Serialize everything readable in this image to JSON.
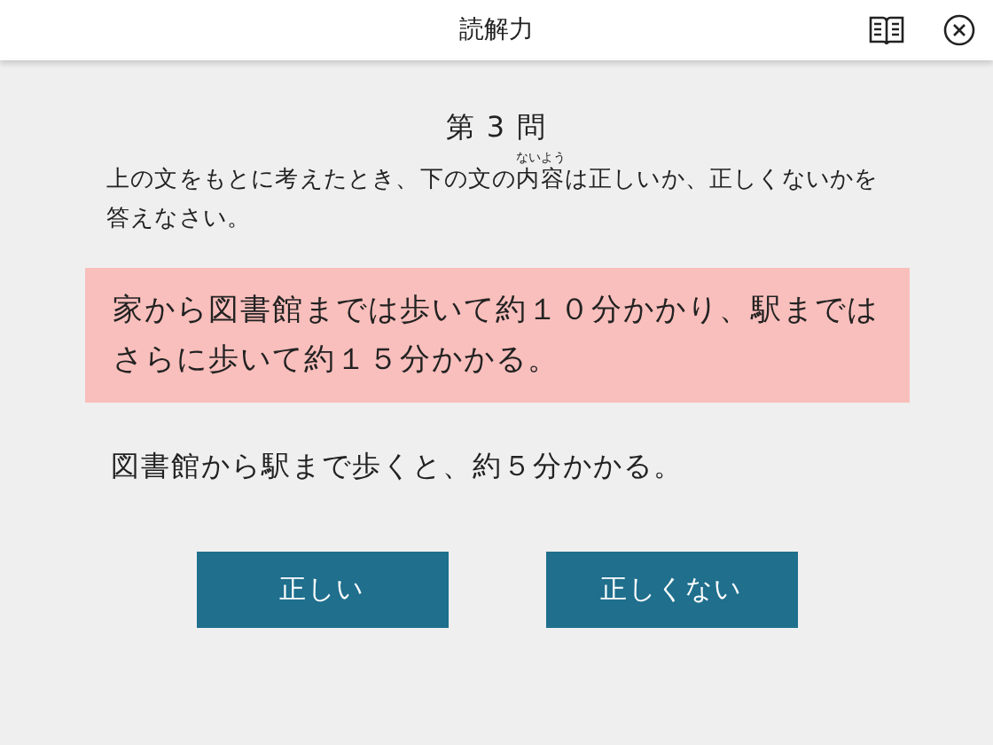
{
  "header": {
    "title": "読解力"
  },
  "question": {
    "number": "第 3 問",
    "instruction": {
      "before": "上の文をもとに考えたとき、下の文の",
      "ruby_base": "内容",
      "ruby_text": "ないよう",
      "after": "は正しいか、正しくないかを答えなさい。"
    },
    "passage": "家から図書館までは歩いて約１０分かかり、駅まではさらに歩いて約１５分かかる。",
    "statement": "図書館から駅まで歩くと、約５分かかる。"
  },
  "answers": [
    {
      "label": "正しい"
    },
    {
      "label": "正しくない"
    }
  ]
}
